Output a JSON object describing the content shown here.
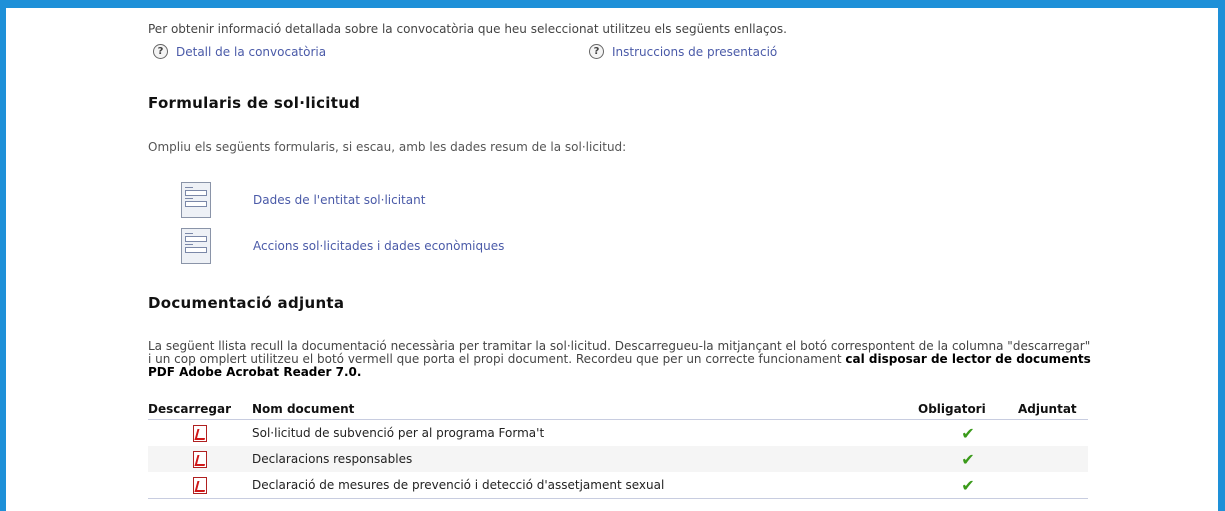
{
  "intro": {
    "text": "Per obtenir informació detallada sobre la convocatòria que heu seleccionat utilitzeu els següents enllaços.",
    "link_detail": "Detall de la convocatòria",
    "link_instructions": "Instruccions de presentació"
  },
  "forms": {
    "title": "Formularis de sol·licitud",
    "description": "Ompliu els següents formularis, si escau, amb les dades resum de la sol·licitud:",
    "items": [
      {
        "label": "Dades de l'entitat sol·licitant"
      },
      {
        "label": "Accions sol·licitades i dades econòmiques"
      }
    ]
  },
  "docs": {
    "title": "Documentació adjunta",
    "desc_1": "La següent llista recull la documentació necessària per tramitar la sol·licitud. Descarregueu-la mitjançant el botó correspontent de la columna \"descarregar\" i un cop omplert utilitzeu el botó vermell que porta el propi document. Recordeu que per un correcte funcionament ",
    "desc_bold": "cal disposar de lector de documents PDF Adobe Acrobat Reader 7.0.",
    "columns": {
      "download": "Descarregar",
      "name": "Nom document",
      "required": "Obligatori",
      "attached": "Adjuntat"
    },
    "rows": [
      {
        "name": "Sol·licitud de subvenció per al programa Forma't",
        "required": "✔",
        "attached": ""
      },
      {
        "name": "Declaracions responsables",
        "required": "✔",
        "attached": ""
      },
      {
        "name": "Declaració de mesures de prevenció i detecció d'assetjament sexual",
        "required": "✔",
        "attached": ""
      }
    ]
  },
  "icons": {
    "help": "help-icon",
    "form": "form-icon",
    "pdf": "pdf-icon",
    "check": "check-icon"
  },
  "colors": {
    "frame": "#1e90d8",
    "link": "#4a5aa8",
    "check": "#3a9a1a",
    "pdf": "#d01818"
  }
}
